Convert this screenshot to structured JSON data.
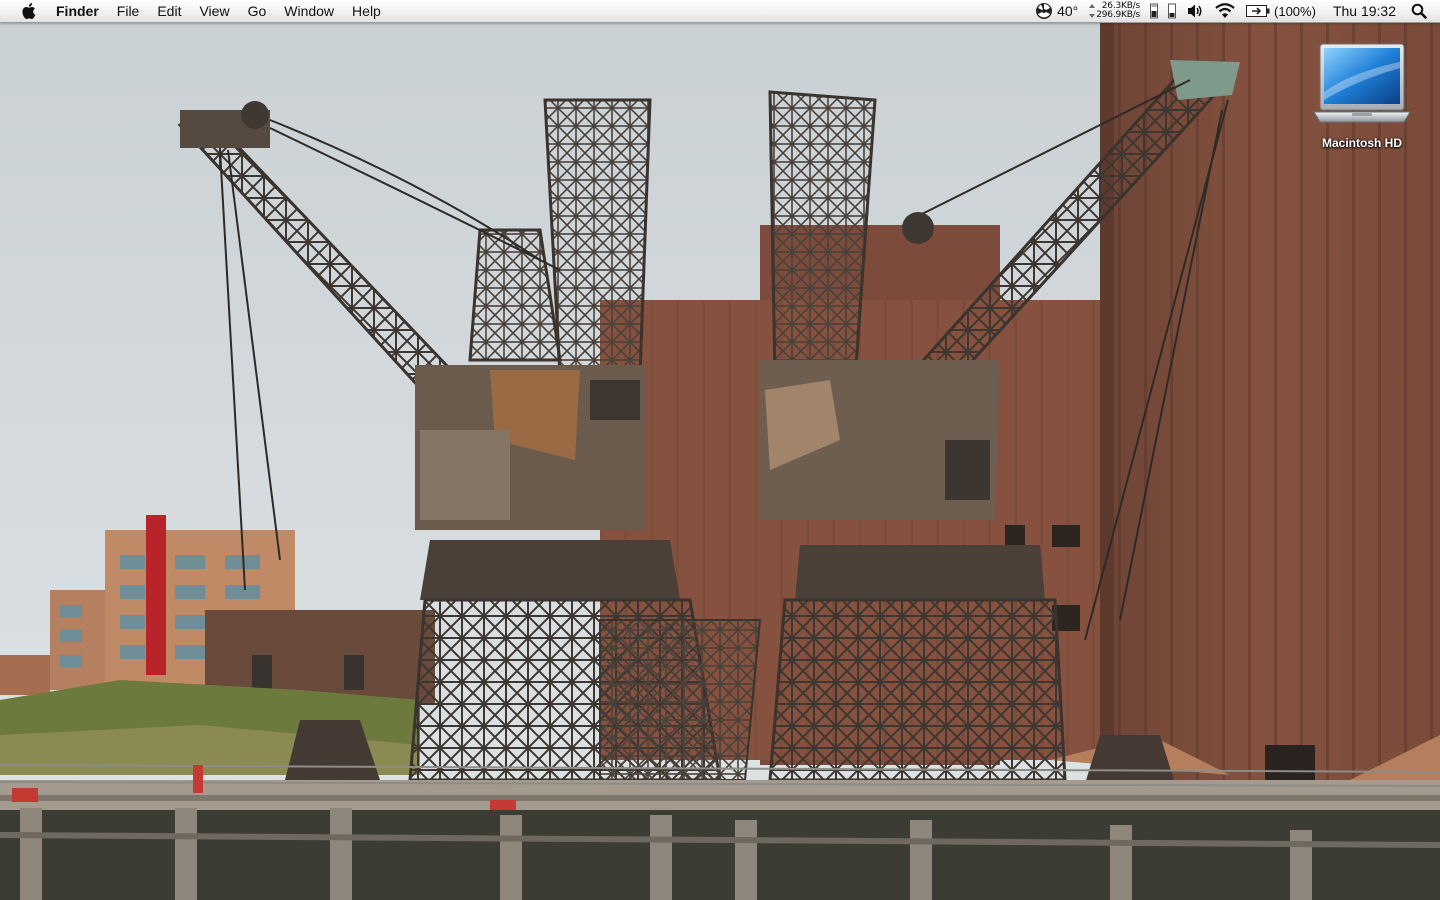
{
  "menubar": {
    "app_name": "Finder",
    "menus": [
      "File",
      "Edit",
      "View",
      "Go",
      "Window",
      "Help"
    ],
    "status": {
      "temperature": "40°",
      "net_up": "26.3KB/s",
      "net_down": "296.9KB/s",
      "battery_percent": "(100%)",
      "clock": "Thu 19:32"
    },
    "icons": [
      "apple-icon",
      "fan-icon",
      "network-activity-icon",
      "cpu-meter-icon",
      "memory-meter-icon",
      "volume-icon",
      "wifi-icon",
      "battery-icon",
      "spotlight-icon"
    ]
  },
  "desktop": {
    "icons": [
      {
        "label": "Macintosh HD",
        "icon": "laptop-drive-icon"
      }
    ]
  },
  "colors": {
    "menubar_top": "#ffffff",
    "menubar_bottom": "#e2e2e2",
    "sky": "#d4dadd",
    "brick": "#7a4a3a",
    "crane_rust": "#5a4a3e"
  }
}
